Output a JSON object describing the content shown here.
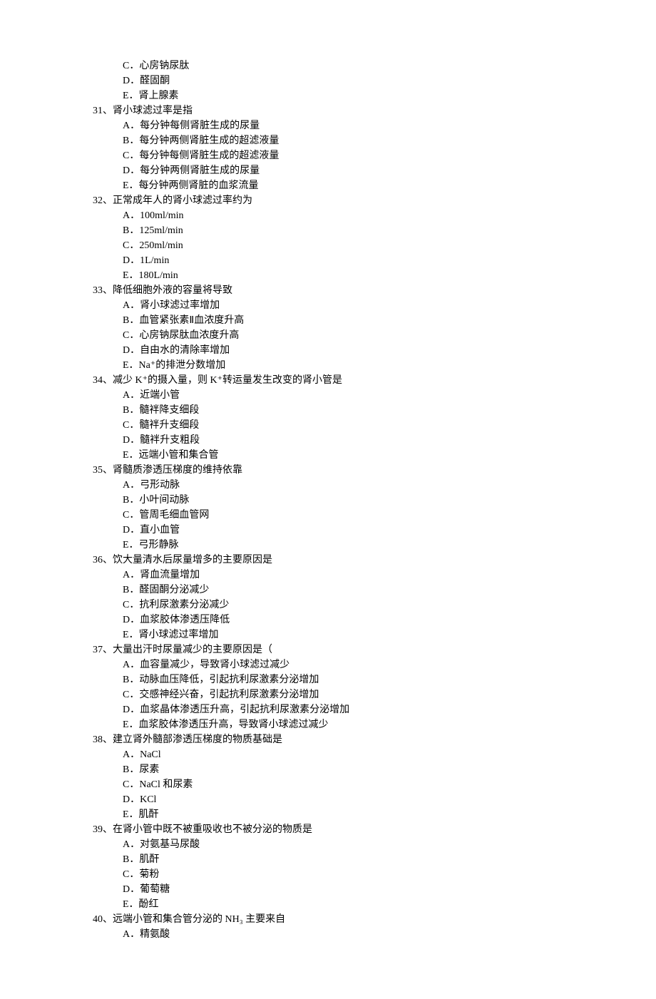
{
  "lines": [
    {
      "cls": "option",
      "text": "C．心房钠尿肽"
    },
    {
      "cls": "option",
      "text": "D．醛固酮"
    },
    {
      "cls": "option",
      "text": "E．肾上腺素"
    },
    {
      "cls": "question",
      "text": "31、肾小球滤过率是指"
    },
    {
      "cls": "option",
      "text": "A．每分钟每侧肾脏生成的尿量"
    },
    {
      "cls": "option",
      "text": "B．每分钟两侧肾脏生成的超滤液量"
    },
    {
      "cls": "option",
      "text": "C．每分钟每侧肾脏生成的超滤液量"
    },
    {
      "cls": "option",
      "text": "D．每分钟两侧肾脏生成的尿量"
    },
    {
      "cls": "option",
      "text": "E．每分钟两侧肾脏的血浆流量"
    },
    {
      "cls": "question",
      "text": "32、正常成年人的肾小球滤过率约为"
    },
    {
      "cls": "option",
      "text": "A．100ml/min"
    },
    {
      "cls": "option",
      "text": "B．125ml/min"
    },
    {
      "cls": "option",
      "text": "C．250ml/min"
    },
    {
      "cls": "option",
      "text": "D．1L/min"
    },
    {
      "cls": "option",
      "text": "E．180L/min"
    },
    {
      "cls": "question",
      "text": "33、降低细胞外液的容量将导致"
    },
    {
      "cls": "option",
      "text": "A．肾小球滤过率增加"
    },
    {
      "cls": "option",
      "text": "B．血管紧张素Ⅱ血浓度升高"
    },
    {
      "cls": "option",
      "text": "C．心房钠尿肽血浓度升高"
    },
    {
      "cls": "option",
      "text": "D．自由水的清除率增加"
    },
    {
      "cls": "option",
      "text": "E．Na⁺的排泄分数增加"
    },
    {
      "cls": "question",
      "text": "34、减少 K⁺的摄入量，则 K⁺转运量发生改变的肾小管是"
    },
    {
      "cls": "option",
      "text": "A．近端小管"
    },
    {
      "cls": "option",
      "text": "B．髓袢降支细段"
    },
    {
      "cls": "option",
      "text": "C．髓袢升支细段"
    },
    {
      "cls": "option",
      "text": "D．髓袢升支粗段"
    },
    {
      "cls": "option",
      "text": "E．远端小管和集合管"
    },
    {
      "cls": "question",
      "text": "35、肾髓质渗透压梯度的维持依靠"
    },
    {
      "cls": "option",
      "text": "A．弓形动脉"
    },
    {
      "cls": "option",
      "text": "B．小叶间动脉"
    },
    {
      "cls": "option",
      "text": "C．管周毛细血管网"
    },
    {
      "cls": "option",
      "text": "D．直小血管"
    },
    {
      "cls": "option",
      "text": "E．弓形静脉"
    },
    {
      "cls": "question",
      "text": "36、饮大量清水后尿量增多的主要原因是"
    },
    {
      "cls": "option",
      "text": "A．肾血流量增加"
    },
    {
      "cls": "option",
      "text": "B．醛固酮分泌减少"
    },
    {
      "cls": "option",
      "text": "C．抗利尿激素分泌减少"
    },
    {
      "cls": "option",
      "text": "D．血浆胶体渗透压降低"
    },
    {
      "cls": "option",
      "text": "E．肾小球滤过率增加"
    },
    {
      "cls": "question",
      "text": "37、大量出汗时尿量减少的主要原因是（"
    },
    {
      "cls": "option",
      "text": "A．血容量减少，导致肾小球滤过减少"
    },
    {
      "cls": "option",
      "text": "B．动脉血压降低，引起抗利尿激素分泌增加"
    },
    {
      "cls": "option",
      "text": "C．交感神经兴奋，引起抗利尿激素分泌增加"
    },
    {
      "cls": "option",
      "text": "D．血浆晶体渗透压升高，引起抗利尿激素分泌增加"
    },
    {
      "cls": "option",
      "text": "E．血浆胶体渗透压升高，导致肾小球滤过减少"
    },
    {
      "cls": "question",
      "text": "38、建立肾外髓部渗透压梯度的物质基础是"
    },
    {
      "cls": "option",
      "text": "A．NaCl"
    },
    {
      "cls": "option",
      "text": "B．尿素"
    },
    {
      "cls": "option",
      "text": "C．NaCl 和尿素"
    },
    {
      "cls": "option",
      "text": "D．KCl"
    },
    {
      "cls": "option",
      "text": "E．肌酐"
    },
    {
      "cls": "question",
      "text": "39、在肾小管中既不被重吸收也不被分泌的物质是"
    },
    {
      "cls": "option",
      "text": "A．对氨基马尿酸"
    },
    {
      "cls": "option",
      "text": "B．肌酐"
    },
    {
      "cls": "option",
      "text": "C．菊粉"
    },
    {
      "cls": "option",
      "text": "D．葡萄糖"
    },
    {
      "cls": "option",
      "text": "E．酚红"
    },
    {
      "cls": "question",
      "text": "40、远端小管和集合管分泌的 NH₃ 主要来自"
    },
    {
      "cls": "option",
      "text": "A．精氨酸"
    }
  ]
}
